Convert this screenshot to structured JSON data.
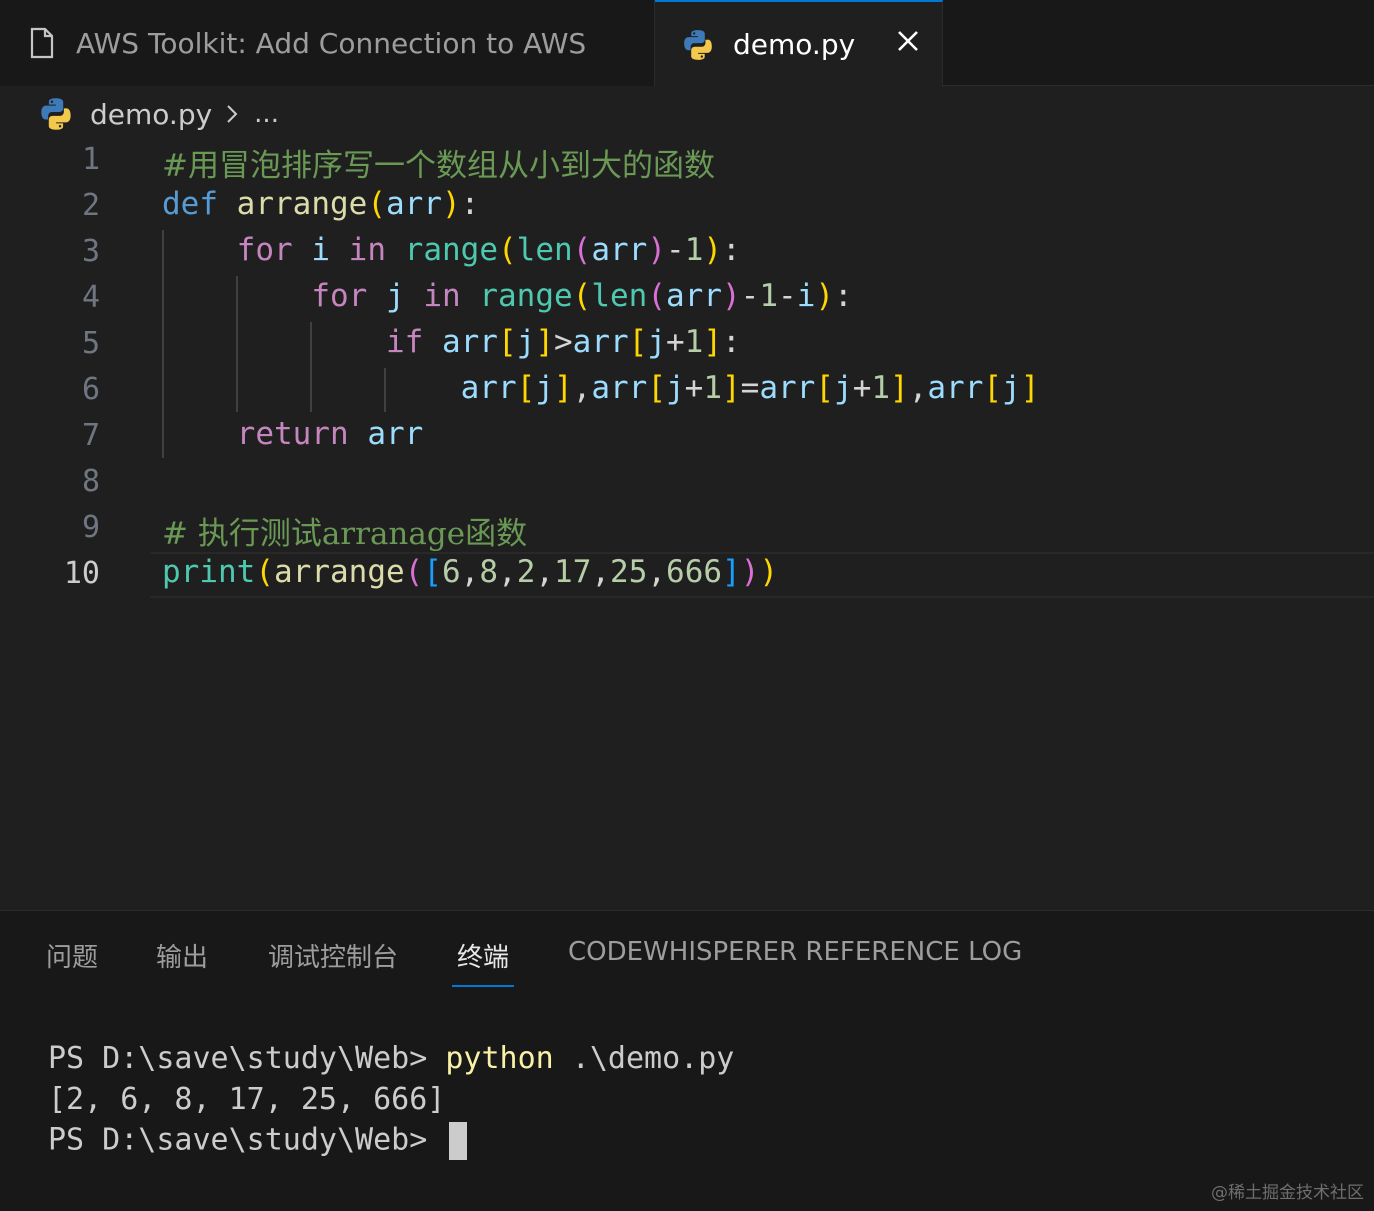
{
  "tabs": [
    {
      "label": "AWS Toolkit: Add Connection to AWS",
      "active": false
    },
    {
      "label": "demo.py",
      "active": true
    }
  ],
  "breadcrumb": {
    "file": "demo.py",
    "more": "..."
  },
  "editor": {
    "line_numbers": [
      "1",
      "2",
      "3",
      "4",
      "5",
      "6",
      "7",
      "8",
      "9",
      "10"
    ],
    "active_line": "10",
    "code": [
      "#用冒泡排序写一个数组从小到大的函数",
      "def arrange(arr):",
      "    for i in range(len(arr)-1):",
      "        for j in range(len(arr)-1-i):",
      "            if arr[j]>arr[j+1]:",
      "                arr[j],arr[j+1]=arr[j+1],arr[j]",
      "    return arr",
      "",
      "# 执行测试arranage函数",
      "print(arrange([6,8,2,17,25,666]))"
    ]
  },
  "panel": {
    "tabs": [
      "问题",
      "输出",
      "调试控制台",
      "终端",
      "CODEWHISPERER REFERENCE LOG"
    ],
    "active_tab": "终端",
    "terminal": {
      "prompt1": "PS D:\\save\\study\\Web> ",
      "command": "python",
      "args": " .\\demo.py",
      "output": "[2, 6, 8, 17, 25, 666]",
      "prompt2": "PS D:\\save\\study\\Web> "
    }
  },
  "watermark": "@稀土掘金技术社区",
  "colors": {
    "accent": "#0078d4",
    "keyword": "#569cd6",
    "control": "#c586c0",
    "comment": "#6a9955"
  }
}
